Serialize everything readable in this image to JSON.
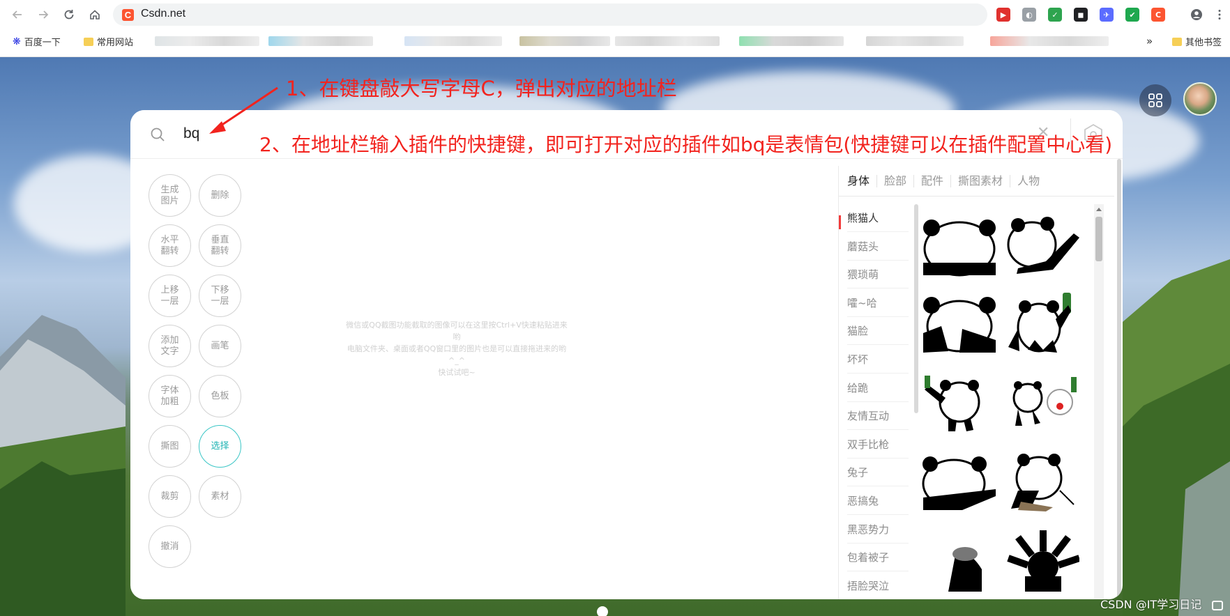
{
  "browser": {
    "url_text": "Csdn.net",
    "favicon_letter": "C",
    "extensions": [
      {
        "name": "video-ext-icon",
        "color": "#e0312e",
        "glyph": "▶"
      },
      {
        "name": "shield-ext-icon",
        "color": "#9aa0a6",
        "glyph": "◐"
      },
      {
        "name": "adguard-ext-icon",
        "color": "#2ea44f",
        "glyph": "✓"
      },
      {
        "name": "mask-ext-icon",
        "color": "#202124",
        "glyph": "◼"
      },
      {
        "name": "bird-ext-icon",
        "color": "#5b6cff",
        "glyph": "✈"
      },
      {
        "name": "check-ext-icon",
        "color": "#1fa84f",
        "glyph": "✔"
      },
      {
        "name": "csdn-ext-icon",
        "color": "#fc5531",
        "glyph": "C"
      }
    ],
    "bookmarks": {
      "baidu": "百度一下",
      "common_sites": "常用网站",
      "more": "»",
      "other": "其他书签"
    }
  },
  "search": {
    "query": "bq"
  },
  "tools": [
    {
      "label": "生成\n图片",
      "name": "generate-image-button",
      "active": false
    },
    {
      "label": "删除",
      "name": "delete-button",
      "active": false
    },
    {
      "label": "水平\n翻转",
      "name": "flip-horizontal-button",
      "active": false
    },
    {
      "label": "垂直\n翻转",
      "name": "flip-vertical-button",
      "active": false
    },
    {
      "label": "上移\n一层",
      "name": "move-up-layer-button",
      "active": false
    },
    {
      "label": "下移\n一层",
      "name": "move-down-layer-button",
      "active": false
    },
    {
      "label": "添加\n文字",
      "name": "add-text-button",
      "active": false
    },
    {
      "label": "画笔",
      "name": "brush-button",
      "active": false
    },
    {
      "label": "字体\n加粗",
      "name": "bold-font-button",
      "active": false
    },
    {
      "label": "色板",
      "name": "palette-button",
      "active": false
    },
    {
      "label": "撕图",
      "name": "tear-image-button",
      "active": false
    },
    {
      "label": "选择",
      "name": "select-button",
      "active": true
    },
    {
      "label": "裁剪",
      "name": "crop-button",
      "active": false
    },
    {
      "label": "素材",
      "name": "material-button",
      "active": false
    },
    {
      "label": "撤消",
      "name": "undo-button",
      "active": false
    }
  ],
  "canvas_hint": "微信或QQ截图功能截取的图像可以在这里按Ctrl+V快速粘贴进来哟\n电脑文件夹、桌面或者QQ窗口里的图片也是可以直接拖进来的哟 ^_^\n快试试吧~",
  "category_tabs": [
    {
      "label": "身体",
      "active": true
    },
    {
      "label": "脸部",
      "active": false
    },
    {
      "label": "配件",
      "active": false
    },
    {
      "label": "撕图素材",
      "active": false
    },
    {
      "label": "人物",
      "active": false
    }
  ],
  "sub_categories": [
    "熊猫人",
    "蘑菇头",
    "猥琐萌",
    "嚯~哈",
    "猫脸",
    "坏坏",
    "给跪",
    "友情互动",
    "双手比枪",
    "兔子",
    "恶搞兔",
    "黑恶势力",
    "包着被子",
    "捂脸哭泣"
  ],
  "annotations": {
    "step1": "1、在键盘敲大写字母C，弹出对应的地址栏",
    "step2": "2、在地址栏输入插件的快捷键，即可打开对应的插件如bq是表情包(快捷键可以在插件配置中心看)"
  },
  "watermark": "CSDN @IT学习日记",
  "colors": {
    "accent_teal": "#3ac6c6",
    "annotation_red": "#f2231e",
    "csdn_orange": "#fc5531",
    "active_mark_red": "#f23b3b"
  }
}
